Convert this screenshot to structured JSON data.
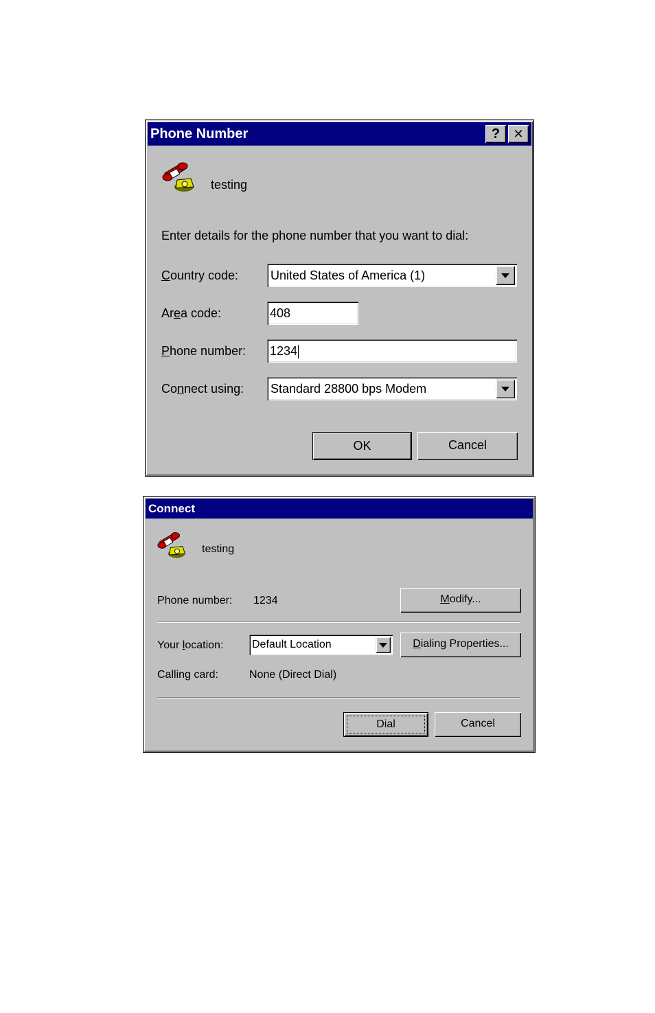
{
  "phone_dialog": {
    "title": "Phone Number",
    "help_button": "?",
    "close_button": "✕",
    "connection_name": "testing",
    "prompt": "Enter details for the phone number that you want to dial:",
    "country_label": {
      "pre": "",
      "u": "C",
      "post": "ountry code:"
    },
    "country_value": "United States of America (1)",
    "area_label": {
      "pre": "Ar",
      "u": "e",
      "post": "a code:"
    },
    "area_value": "408",
    "phone_label": {
      "pre": "",
      "u": "P",
      "post": "hone number:"
    },
    "phone_value": "1234",
    "connect_label": {
      "pre": "Co",
      "u": "n",
      "post": "nect using:"
    },
    "connect_value": "Standard 28800 bps Modem",
    "ok_label": "OK",
    "cancel_label": "Cancel"
  },
  "connect_dialog": {
    "title": "Connect",
    "connection_name": "testing",
    "phone_label": "Phone number:",
    "phone_value": "1234",
    "modify_label": {
      "pre": "",
      "u": "M",
      "post": "odify..."
    },
    "location_label": {
      "pre": "Your ",
      "u": "l",
      "post": "ocation:"
    },
    "location_value": "Default Location",
    "dialing_label": {
      "pre": "",
      "u": "D",
      "post": "ialing Properties..."
    },
    "card_label": "Calling card:",
    "card_value": "None (Direct Dial)",
    "dial_label": "Dial",
    "cancel_label": "Cancel"
  },
  "icons": [
    "telephone-icon",
    "help-icon",
    "close-icon",
    "dropdown-arrow-icon"
  ],
  "colors": {
    "titlebar": "#000080",
    "face": "#c0c0c0",
    "phone_red": "#cc0000",
    "phone_yellow": "#ffff00"
  }
}
